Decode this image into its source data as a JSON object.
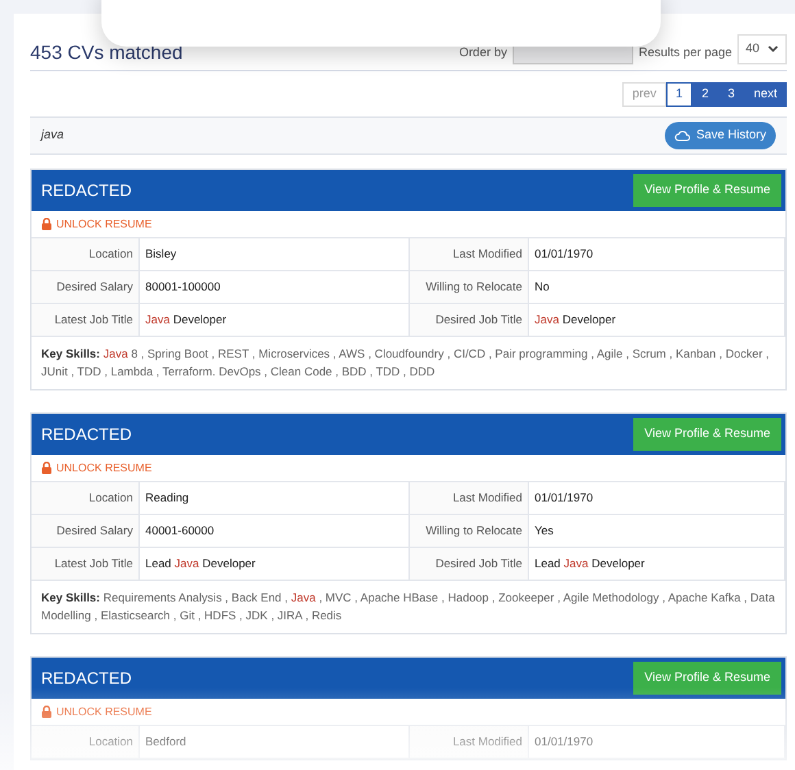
{
  "summary": {
    "count": "453 CVs matched",
    "order_label": "Order by",
    "per_page_label": "Results per page",
    "per_page_value": "40"
  },
  "pagination": [
    {
      "label": "prev",
      "kind": "nav",
      "selected": false
    },
    {
      "label": "1",
      "kind": "page",
      "selected": true
    },
    {
      "label": "2",
      "kind": "page",
      "selected": false
    },
    {
      "label": "3",
      "kind": "page",
      "selected": false
    },
    {
      "label": "next",
      "kind": "nav",
      "selected": false
    }
  ],
  "search": {
    "query": "java",
    "save_button": "Save History"
  },
  "results": [
    {
      "name": "REDACTED",
      "action": "View Profile & Resume",
      "unlock": "UNLOCK RESUME",
      "fields": [
        {
          "label": "Location",
          "value": [
            {
              "text": "Bisley",
              "match": false
            }
          ]
        },
        {
          "label": "Last Modified",
          "value": [
            {
              "text": "01/01/1970",
              "match": false
            }
          ]
        },
        {
          "label": "Desired Salary",
          "value": [
            {
              "text": "80001-100000",
              "match": false
            }
          ]
        },
        {
          "label": "Willing to Relocate",
          "value": [
            {
              "text": "No",
              "match": false
            }
          ]
        },
        {
          "label": "Latest Job Title",
          "value": [
            {
              "text": "Java",
              "match": true
            },
            {
              "text": " Developer",
              "match": false
            }
          ]
        },
        {
          "label": "Desired Job Title",
          "value": [
            {
              "text": "Java",
              "match": true
            },
            {
              "text": " Developer",
              "match": false
            }
          ]
        }
      ],
      "skills_label": "Key Skills:",
      "skills": [
        {
          "text": "Java",
          "match": true
        },
        {
          "text": " 8 , Spring Boot , REST , Microservices , AWS , Cloudfoundry , CI/CD , Pair programming , Agile , Scrum , Kanban , Docker , JUnit , TDD , Lambda , Terraform. DevOps , Clean Code , BDD , TDD , DDD",
          "match": false
        }
      ]
    },
    {
      "name": "REDACTED",
      "action": "View Profile & Resume",
      "unlock": "UNLOCK RESUME",
      "fields": [
        {
          "label": "Location",
          "value": [
            {
              "text": "Reading",
              "match": false
            }
          ]
        },
        {
          "label": "Last Modified",
          "value": [
            {
              "text": "01/01/1970",
              "match": false
            }
          ]
        },
        {
          "label": "Desired Salary",
          "value": [
            {
              "text": "40001-60000",
              "match": false
            }
          ]
        },
        {
          "label": "Willing to Relocate",
          "value": [
            {
              "text": "Yes",
              "match": false
            }
          ]
        },
        {
          "label": "Latest Job Title",
          "value": [
            {
              "text": "Lead ",
              "match": false
            },
            {
              "text": "Java",
              "match": true
            },
            {
              "text": " Developer",
              "match": false
            }
          ]
        },
        {
          "label": "Desired Job Title",
          "value": [
            {
              "text": "Lead ",
              "match": false
            },
            {
              "text": "Java",
              "match": true
            },
            {
              "text": " Developer",
              "match": false
            }
          ]
        }
      ],
      "skills_label": "Key Skills:",
      "skills": [
        {
          "text": "Requirements Analysis , Back End , ",
          "match": false
        },
        {
          "text": "Java",
          "match": true
        },
        {
          "text": " , MVC , Apache HBase , Hadoop , Zookeeper , Agile Methodology , Apache Kafka , Data Modelling , Elasticsearch , Git , HDFS , JDK , JIRA , Redis",
          "match": false
        }
      ]
    },
    {
      "name": "REDACTED",
      "action": "View Profile & Resume",
      "unlock": "UNLOCK RESUME",
      "fields": [
        {
          "label": "Location",
          "value": [
            {
              "text": "Bedford",
              "match": false
            }
          ]
        },
        {
          "label": "Last Modified",
          "value": [
            {
              "text": "01/01/1970",
              "match": false
            }
          ]
        }
      ]
    }
  ]
}
